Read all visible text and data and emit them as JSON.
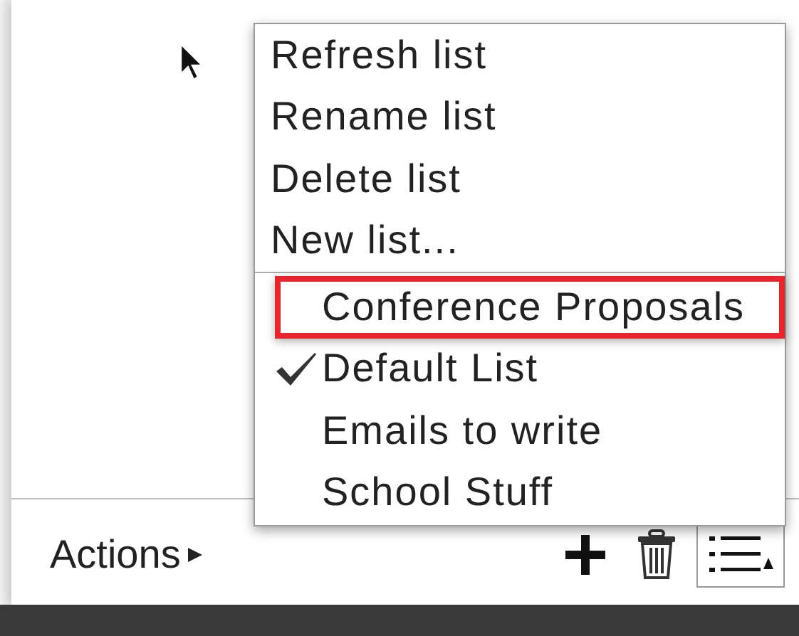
{
  "menu": {
    "actions": [
      {
        "label": "Refresh list"
      },
      {
        "label": "Rename list"
      },
      {
        "label": "Delete list"
      },
      {
        "label": "New list..."
      }
    ],
    "lists": [
      {
        "label": "Conference Proposals",
        "checked": false,
        "highlighted": true
      },
      {
        "label": "Default List",
        "checked": true,
        "highlighted": false
      },
      {
        "label": "Emails to write",
        "checked": false,
        "highlighted": false
      },
      {
        "label": "School Stuff",
        "checked": false,
        "highlighted": false
      }
    ]
  },
  "toolbar": {
    "actions_label": "Actions"
  }
}
